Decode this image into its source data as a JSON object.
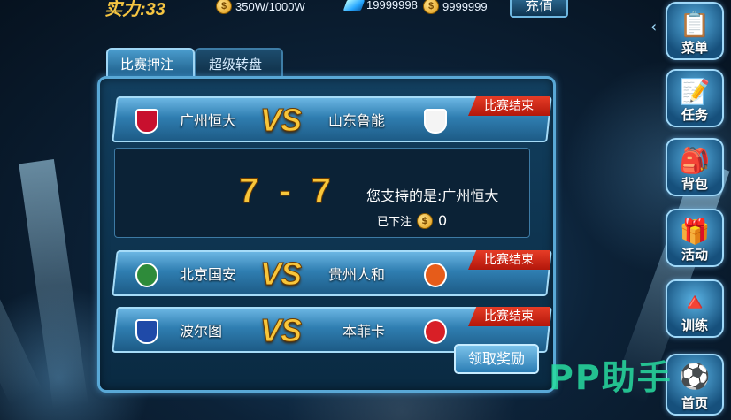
{
  "top_bar": {
    "strength_label": "实力:",
    "strength_value": "33",
    "stamina": "350W/1000W",
    "gems": "19999998",
    "coins": "9999999",
    "recharge_label": "充值"
  },
  "tabs": [
    {
      "label": "比赛押注",
      "active": true
    },
    {
      "label": "超级转盘",
      "active": false
    }
  ],
  "matches": [
    {
      "home": "广州恒大",
      "away": "山东鲁能",
      "vs": "VS",
      "status": "比赛结束",
      "home_color": "#c8102e",
      "away_color": "#f4f4f4"
    },
    {
      "home": "北京国安",
      "away": "贵州人和",
      "vs": "VS",
      "status": "比赛结束",
      "home_color": "#2e8b3a",
      "away_color": "#e65c1a"
    },
    {
      "home": "波尔图",
      "away": "本菲卡",
      "vs": "VS",
      "status": "比赛结束",
      "home_color": "#1f4aa8",
      "away_color": "#d81f26"
    }
  ],
  "detail": {
    "score": "7 - 7",
    "support_text": "您支持的是:广州恒大",
    "bet_label": "已下注",
    "bet_amount": "0"
  },
  "claim_button": "领取奖励",
  "side_menu": [
    {
      "label": "菜单",
      "icon": "notepad-icon"
    },
    {
      "label": "任务",
      "icon": "quill-icon"
    },
    {
      "label": "背包",
      "icon": "backpack-icon"
    },
    {
      "label": "活动",
      "icon": "gift-icon"
    },
    {
      "label": "训练",
      "icon": "cone-icon"
    },
    {
      "label": "首页",
      "icon": "pitch-icon"
    }
  ],
  "watermark": "PP助手",
  "colors": {
    "accent_gold": "#f8c63a",
    "status_red": "#d9261a",
    "panel_border": "#59a8d6"
  }
}
